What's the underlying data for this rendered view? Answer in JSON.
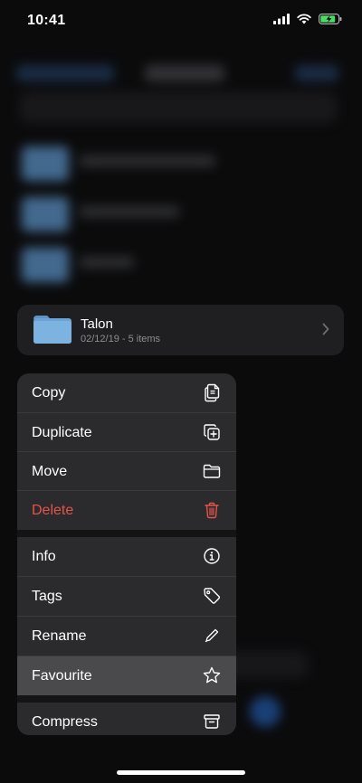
{
  "status": {
    "time": "10:41"
  },
  "folder": {
    "name": "Talon",
    "meta": "02/12/19 - 5 items"
  },
  "menu": {
    "items": [
      {
        "label": "Copy",
        "icon": "copy-icon"
      },
      {
        "label": "Duplicate",
        "icon": "duplicate-icon"
      },
      {
        "label": "Move",
        "icon": "folder-icon"
      },
      {
        "label": "Delete",
        "icon": "trash-icon",
        "destructive": true
      },
      {
        "label": "Info",
        "icon": "info-icon"
      },
      {
        "label": "Tags",
        "icon": "tag-icon"
      },
      {
        "label": "Rename",
        "icon": "pencil-icon"
      },
      {
        "label": "Favourite",
        "icon": "star-icon",
        "highlighted": true
      },
      {
        "label": "Compress",
        "icon": "archive-icon"
      }
    ]
  },
  "colors": {
    "destructive": "#e5534b",
    "folder": "#6aa3d6",
    "battery": "#4cd964"
  }
}
